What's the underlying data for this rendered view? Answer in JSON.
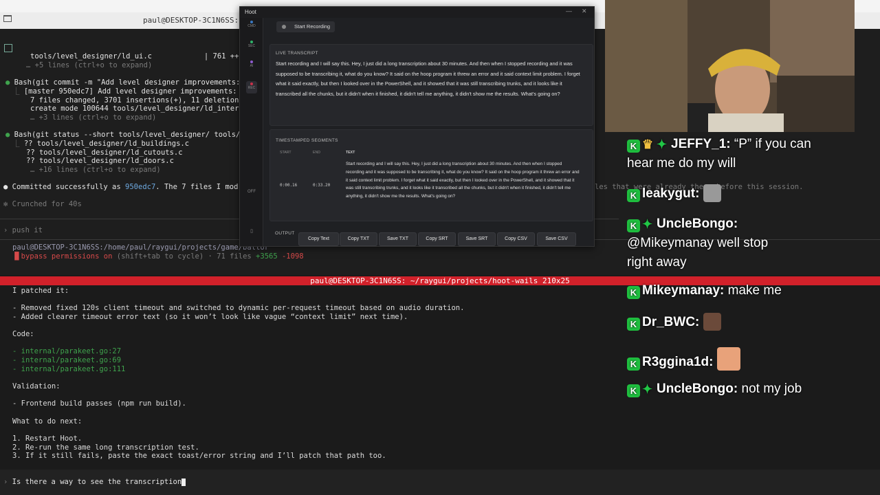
{
  "top_terminal": {
    "window_title": "paul@DESKTOP-3C1N6SS: ~/ra",
    "lines": [
      {
        "text": "tools/level_designer/ld_ui.c            | 761 ++",
        "cls": "white"
      },
      {
        "text": "… +5 lines (ctrl+o to expand)",
        "cls": "dim"
      },
      {
        "text": "Bash(git commit -m \"Add level designer improvements:",
        "cls": "white"
      },
      {
        "text": "[master 950edc7] Add level designer improvements:",
        "cls": "white"
      },
      {
        "text": "7 files changed, 3701 insertions(+), 11 deletion",
        "cls": "white"
      },
      {
        "text": "create mode 100644 tools/level_designer/ld_inter",
        "cls": "white"
      },
      {
        "text": "… +3 lines (ctrl+o to expand)",
        "cls": "dim"
      },
      {
        "text": "Bash(git status --short tools/level_designer/ tools/",
        "cls": "white"
      },
      {
        "text": "?? tools/level_designer/ld_buildings.c",
        "cls": "white"
      },
      {
        "text": "?? tools/level_designer/ld_cutouts.c",
        "cls": "white"
      },
      {
        "text": "?? tools/level_designer/ld_doors.c",
        "cls": "white"
      },
      {
        "text": "… +16 lines (ctrl+o to expand)",
        "cls": "dim"
      }
    ],
    "committed_prefix": "Committed successfully as ",
    "committed_hash": "950edc7",
    "committed_suffix": ". The 7 files I mod",
    "right_fragment": "les that were already there before this session.",
    "crunched": "Crunched for 40s",
    "prompt": "push it",
    "path_line": "paul@DESKTOP-3C1N6SS:/home/paul/raygui/projects/game/baltor",
    "bypass": "bypass permissions on",
    "bypass_rest": "(shift+tab to cycle) · 71 files ",
    "plus": "+3565",
    "minus": "-1098"
  },
  "bottom_terminal": {
    "title": "paul@DESKTOP-3C1N6SS: ~/raygui/projects/hoot-wails 210x25",
    "lines": [
      {
        "text": "I patched it:",
        "cls": "white"
      },
      {
        "text": "",
        "cls": "white"
      },
      {
        "text": "- Removed fixed 120s client timeout and switched to dynamic per-request timeout based on audio duration.",
        "cls": "white"
      },
      {
        "text": "- Added clearer timeout error text (so it won’t look like vague “context limit” next time).",
        "cls": "white"
      },
      {
        "text": "",
        "cls": "white"
      },
      {
        "text": "Code:",
        "cls": "white"
      },
      {
        "text": "",
        "cls": "white"
      },
      {
        "text": "- internal/parakeet.go:27",
        "cls": "green"
      },
      {
        "text": "- internal/parakeet.go:69",
        "cls": "green"
      },
      {
        "text": "- internal/parakeet.go:111",
        "cls": "green"
      },
      {
        "text": "",
        "cls": "white"
      },
      {
        "text": "Validation:",
        "cls": "white"
      },
      {
        "text": "",
        "cls": "white"
      },
      {
        "text": "- Frontend build passes (npm run build).",
        "cls": "white"
      },
      {
        "text": "",
        "cls": "white"
      },
      {
        "text": "What to do next:",
        "cls": "white"
      },
      {
        "text": "",
        "cls": "white"
      },
      {
        "text": "1. Restart Hoot.",
        "cls": "white"
      },
      {
        "text": "2. Re-run the same long transcription test.",
        "cls": "white"
      },
      {
        "text": "3. If it still fails, paste the exact toast/error string and I’ll patch that path too.",
        "cls": "white"
      }
    ],
    "input": "Is there a way to see the transcription"
  },
  "hoot": {
    "title": "Hoot",
    "sidebar": [
      {
        "label": "CMD",
        "color": "#3a78c2"
      },
      {
        "label": "SEC",
        "color": "#2fb36b"
      },
      {
        "label": "AI",
        "color": "#8e5bd0"
      },
      {
        "label": "REC",
        "color": "#c9324a"
      },
      {
        "label": "OFF",
        "color": "#555"
      }
    ],
    "start_recording": "Start Recording",
    "live_title": "LIVE TRANSCRIPT",
    "live_text": "Start recording and I will say this. Hey, I just did a long transcription about 30 minutes. And then when I stopped recording and it was supposed to be transcribing it, what do you know? It said on the hoop program it threw an error and it said context limit problem. I forget what it said exactly, but then I looked over in the PowerShell, and it showed that it was still transcribing trunks, and it looks like it transcribed all the chunks, but it didn't when it finished, it didn't tell me anything, it didn't show me the results. What's going on?",
    "seg_title": "TIMESTAMPED SEGMENTS",
    "col_start": "START",
    "col_end": "END",
    "col_text": "TEXT",
    "seg_start": "0:00.16",
    "seg_end": "0:33.20",
    "seg_text": "Start recording and I will say this. Hey, I just did a long transcription about 30 minutes. And then when I stopped recording and it was supposed to be transcribing it, what do you know? It said on the hoop program it threw an error and it said context limit problem. I forget what it said exactly, but then I looked over in the PowerShell, and it showed that it was still transcribing trunks, and it looks like it transcribed all the chunks, but it didn't when it finished, it didn't tell me anything, it didn't show me the results. What's going on?",
    "output_label": "OUTPUT",
    "buttons": [
      "Copy Text",
      "Copy TXT",
      "Save TXT",
      "Copy SRT",
      "Save SRT",
      "Copy CSV",
      "Save CSV"
    ]
  },
  "chat": [
    {
      "user": "JEFFY_1:",
      "msg": "“P” if you can hear me do my will",
      "user_color": "#ffffff"
    },
    {
      "user": "leakygut:",
      "msg": "",
      "user_color": "#ffffff"
    },
    {
      "user": "UncleBongo:",
      "msg": "@Mikeymanay well stop right away",
      "user_color": "#ffffff"
    },
    {
      "user": "Mikeymanay:",
      "msg": "make me",
      "user_color": "#ffffff"
    },
    {
      "user": "Dr_BWC:",
      "msg": "",
      "user_color": "#ffffff"
    },
    {
      "user": "R3ggina1d:",
      "msg": "",
      "user_color": "#ffffff"
    },
    {
      "user": "UncleBongo:",
      "msg": "not my job",
      "user_color": "#ffffff"
    }
  ]
}
